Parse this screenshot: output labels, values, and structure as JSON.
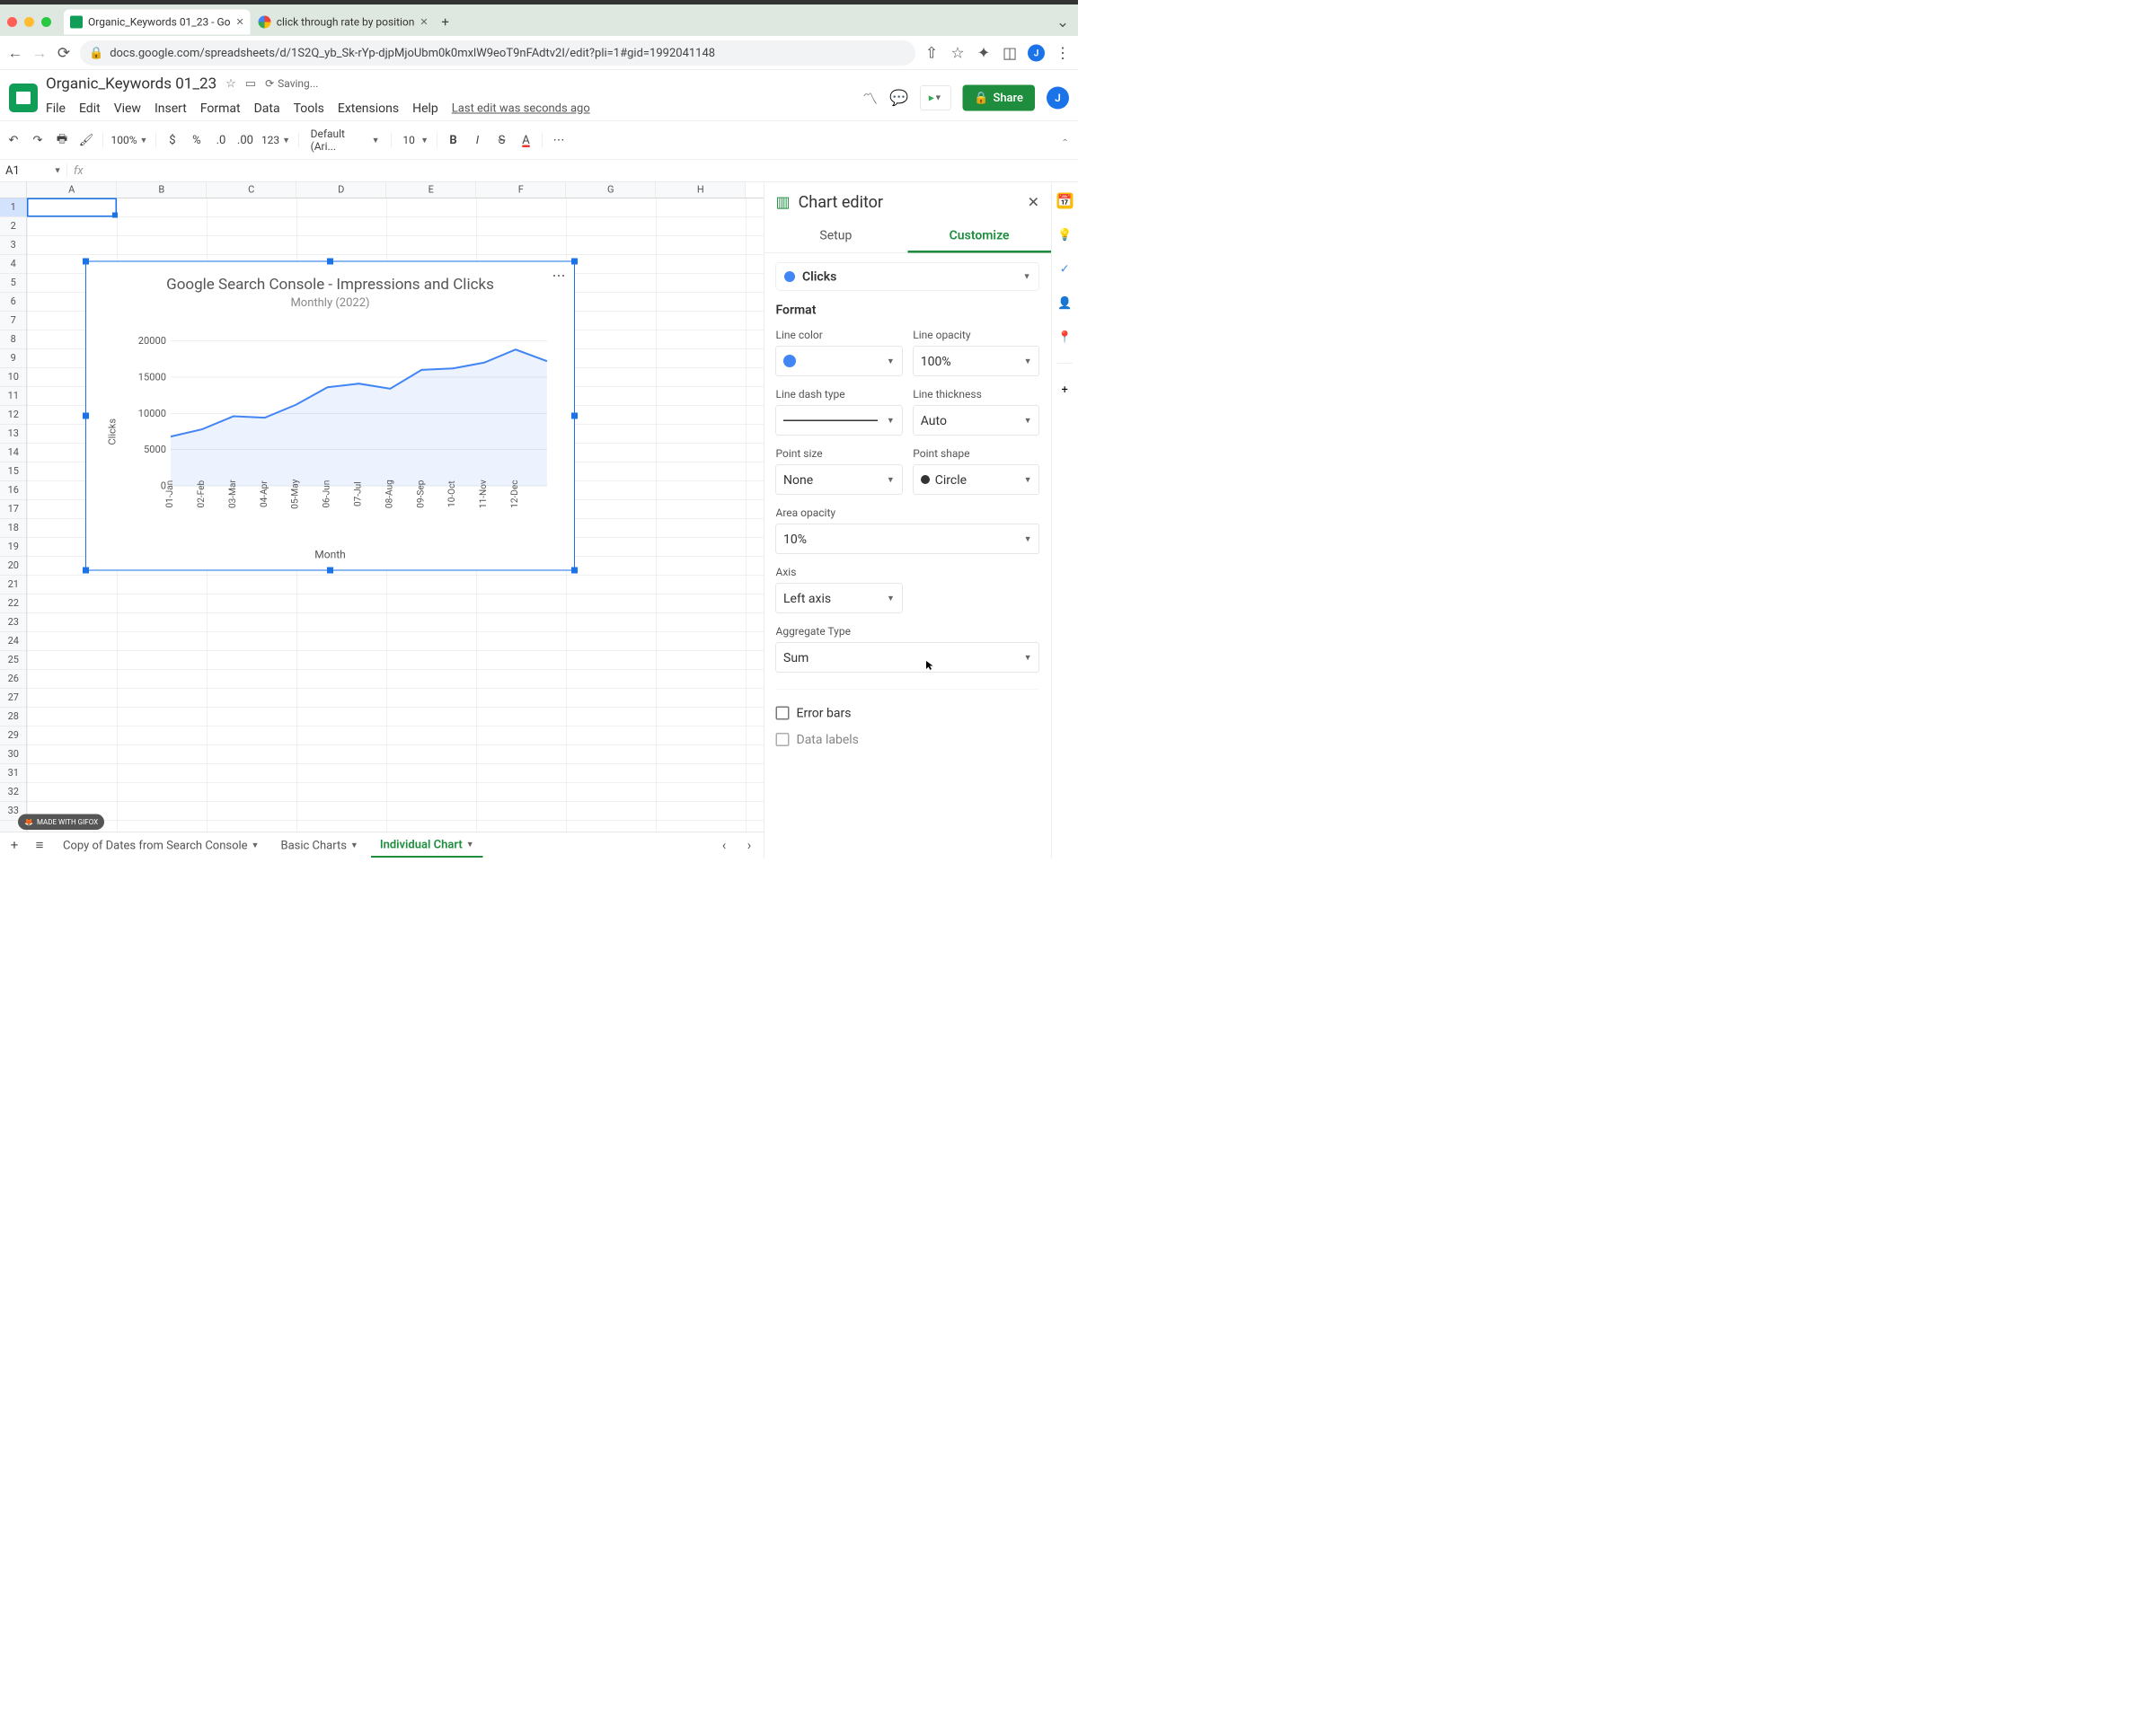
{
  "browser": {
    "tabs": [
      {
        "title": "Organic_Keywords 01_23 - Go",
        "favicon_color": "#0f9d58"
      },
      {
        "title": "click through rate by position",
        "favicon_color": "#ffffff"
      }
    ],
    "url_display": "docs.google.com/spreadsheets/d/1S2Q_yb_Sk-rYp-djpMjoUbm0k0mxlW9eoT9nFAdtv2I/edit?pli=1#gid=1992041148",
    "avatar_initial": "J"
  },
  "sheets": {
    "doc_name": "Organic_Keywords 01_23",
    "saving_text": "Saving...",
    "menus": [
      "File",
      "Edit",
      "View",
      "Insert",
      "Format",
      "Data",
      "Tools",
      "Extensions",
      "Help"
    ],
    "last_edit": "Last edit was seconds ago",
    "toolbar": {
      "zoom": "100%",
      "font": "Default (Ari...",
      "font_size": "10"
    },
    "cell_ref": "A1",
    "columns": [
      "A",
      "B",
      "C",
      "D",
      "E",
      "F",
      "G",
      "H"
    ],
    "rows_count": 33,
    "selected_row": 1,
    "sheet_tabs": {
      "tabs": [
        "Copy of Dates from Search Console",
        "Basic Charts",
        "Individual Chart"
      ],
      "active_index": 2
    },
    "share_label": "Share"
  },
  "chart_editor": {
    "title": "Chart editor",
    "tabs": {
      "setup": "Setup",
      "customize": "Customize"
    },
    "series_name": "Clicks",
    "section_format": "Format",
    "labels": {
      "line_color": "Line color",
      "line_opacity": "Line opacity",
      "line_dash": "Line dash type",
      "line_thickness": "Line thickness",
      "point_size": "Point size",
      "point_shape": "Point shape",
      "area_opacity": "Area opacity",
      "axis": "Axis",
      "aggregate": "Aggregate Type",
      "error_bars": "Error bars",
      "data_labels": "Data labels"
    },
    "values": {
      "line_opacity": "100%",
      "line_thickness": "Auto",
      "point_size": "None",
      "point_shape": "Circle",
      "area_opacity": "10%",
      "axis": "Left axis",
      "aggregate": "Sum"
    }
  },
  "chart_data": {
    "type": "area",
    "title": "Google Search Console - Impressions and Clicks",
    "subtitle": "Monthly (2022)",
    "xlabel": "Month",
    "ylabel": "Clicks",
    "ylim": [
      0,
      20000
    ],
    "y_ticks": [
      0,
      5000,
      10000,
      15000,
      20000
    ],
    "categories": [
      "01-Jan",
      "02-Feb",
      "03-Mar",
      "04-Apr",
      "05-May",
      "06-Jun",
      "07-Jul",
      "08-Aug",
      "09-Sep",
      "10-Oct",
      "11-Nov",
      "12-Dec"
    ],
    "series": [
      {
        "name": "Clicks",
        "color": "#4285f4",
        "values": [
          6800,
          7800,
          9600,
          9400,
          11200,
          13600,
          14100,
          13400,
          16000,
          16200,
          17000,
          18800,
          17200
        ]
      }
    ]
  },
  "gifox_badge": "MADE WITH GIFOX"
}
